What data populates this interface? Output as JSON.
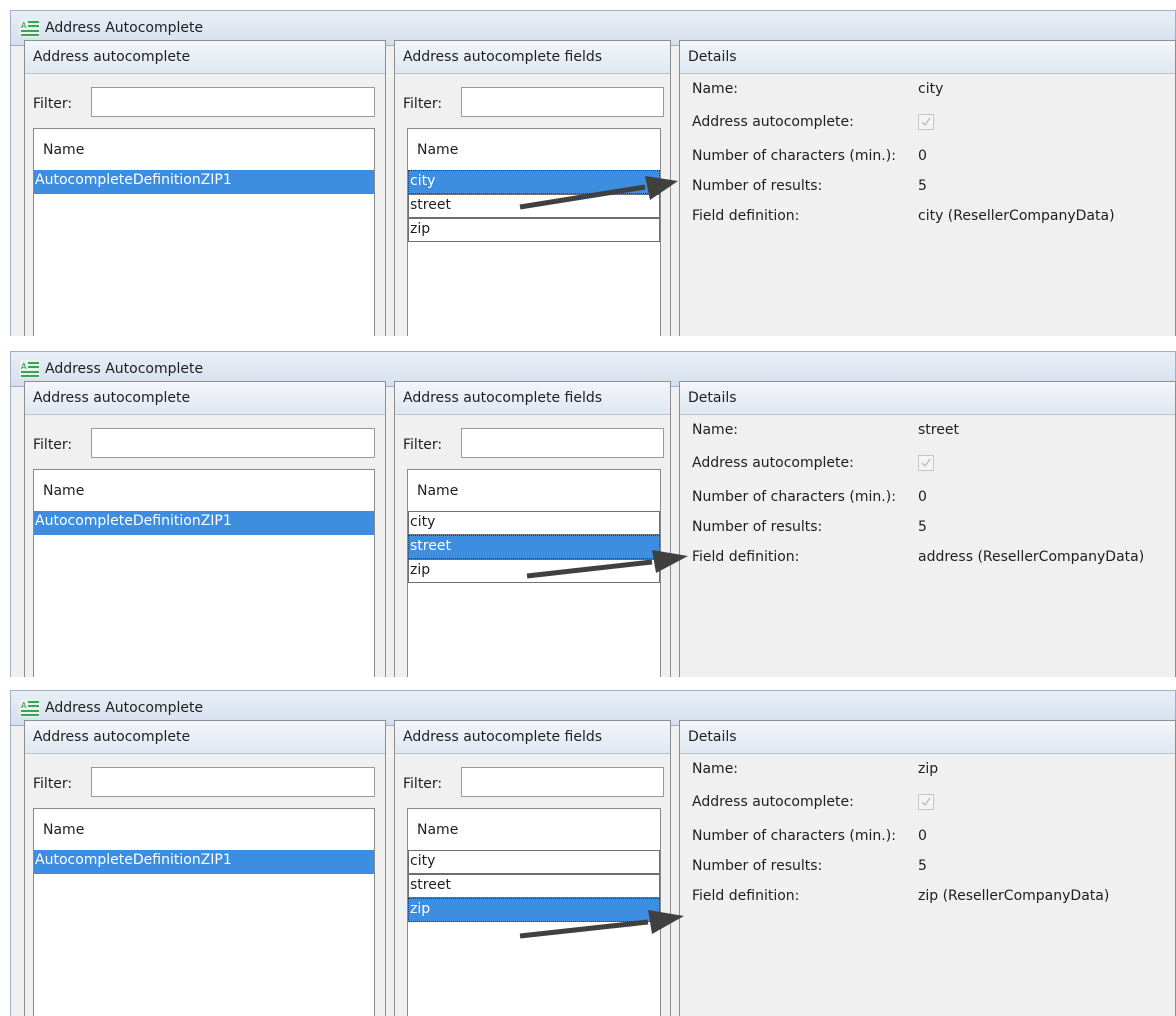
{
  "window": {
    "title": "Address Autocomplete"
  },
  "panels": {
    "autocomplete": {
      "title": "Address autocomplete",
      "filter_label": "Filter:",
      "column": "Name",
      "item": "AutocompleteDefinitionZIP1"
    },
    "fields": {
      "title": "Address autocomplete fields",
      "filter_label": "Filter:",
      "column": "Name",
      "items": [
        "city",
        "street",
        "zip"
      ]
    },
    "details": {
      "title": "Details",
      "labels": {
        "name": "Name:",
        "address_autocomplete": "Address autocomplete:",
        "min_chars": "Number of characters (min.):",
        "results": "Number of results:",
        "field_definition": "Field definition:"
      }
    }
  },
  "shots": [
    {
      "selected_field": "city",
      "details": {
        "name": "city",
        "address_autocomplete": true,
        "min_chars": "0",
        "results": "5",
        "field_definition": "city (ResellerCompanyData)"
      }
    },
    {
      "selected_field": "street",
      "details": {
        "name": "street",
        "address_autocomplete": true,
        "min_chars": "0",
        "results": "5",
        "field_definition": "address (ResellerCompanyData)"
      }
    },
    {
      "selected_field": "zip",
      "details": {
        "name": "zip",
        "address_autocomplete": true,
        "min_chars": "0",
        "results": "5",
        "field_definition": "zip (ResellerCompanyData)"
      }
    }
  ],
  "colors": {
    "selection": "#3d8ee0",
    "arrow": "#404040",
    "titlebar": "#dbe4ef"
  }
}
